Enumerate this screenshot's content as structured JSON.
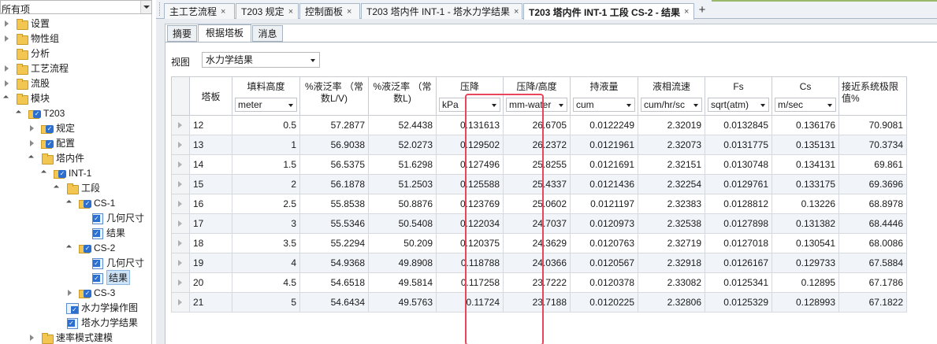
{
  "navigator": {
    "dropdown_value": "所有项",
    "tree": [
      {
        "label": "设置",
        "level": 0,
        "toggle": "col",
        "icon": "folder"
      },
      {
        "label": "物性组",
        "level": 0,
        "toggle": "col",
        "icon": "folder"
      },
      {
        "label": "分析",
        "level": 0,
        "toggle": "none",
        "icon": "folder"
      },
      {
        "label": "工艺流程",
        "level": 0,
        "toggle": "col",
        "icon": "folder"
      },
      {
        "label": "流股",
        "level": 0,
        "toggle": "col",
        "icon": "folder"
      },
      {
        "label": "模块",
        "level": 0,
        "toggle": "exp",
        "icon": "folder"
      },
      {
        "label": "T203",
        "level": 1,
        "toggle": "exp",
        "icon": "fchk"
      },
      {
        "label": "规定",
        "level": 2,
        "toggle": "col",
        "icon": "fchk"
      },
      {
        "label": "配置",
        "level": 2,
        "toggle": "col",
        "icon": "fchk"
      },
      {
        "label": "塔内件",
        "level": 2,
        "toggle": "exp",
        "icon": "folder"
      },
      {
        "label": "INT-1",
        "level": 3,
        "toggle": "exp",
        "icon": "fchk"
      },
      {
        "label": "工段",
        "level": 4,
        "toggle": "exp",
        "icon": "folder"
      },
      {
        "label": "CS-1",
        "level": 5,
        "toggle": "exp",
        "icon": "fchk"
      },
      {
        "label": "几何尺寸",
        "level": 6,
        "toggle": "none",
        "icon": "form"
      },
      {
        "label": "结果",
        "level": 6,
        "toggle": "none",
        "icon": "form"
      },
      {
        "label": "CS-2",
        "level": 5,
        "toggle": "exp",
        "icon": "fchk"
      },
      {
        "label": "几何尺寸",
        "level": 6,
        "toggle": "none",
        "icon": "form"
      },
      {
        "label": "结果",
        "level": 6,
        "toggle": "none",
        "icon": "form",
        "selected": true
      },
      {
        "label": "CS-3",
        "level": 5,
        "toggle": "col",
        "icon": "fchk"
      },
      {
        "label": "水力学操作图",
        "level": 4,
        "toggle": "none",
        "icon": "chart"
      },
      {
        "label": "塔水力学结果",
        "level": 4,
        "toggle": "none",
        "icon": "form"
      },
      {
        "label": "速率模式建模",
        "level": 2,
        "toggle": "col",
        "icon": "folder"
      }
    ]
  },
  "doc_tabs": [
    {
      "label": "主工艺流程",
      "close": "×"
    },
    {
      "label": "T203 规定",
      "close": "×"
    },
    {
      "label": "控制面板",
      "close": "×"
    },
    {
      "label": "T203 塔内件 INT-1 - 塔水力学结果",
      "close": "×"
    },
    {
      "label": "T203 塔内件 INT-1 工段 CS-2 - 结果",
      "close": "×",
      "active": true
    }
  ],
  "add_tab": "+",
  "sub_tabs": [
    {
      "label": "摘要"
    },
    {
      "label": "根据塔板",
      "active": true
    },
    {
      "label": "消息"
    }
  ],
  "view": {
    "label": "视图",
    "value": "水力学结果"
  },
  "columns": [
    {
      "name": "塔板",
      "unit": null
    },
    {
      "name": "填料高度",
      "unit": "meter"
    },
    {
      "name": "%液泛率 （常数L/V)",
      "unit": null
    },
    {
      "name": "%液泛率 （常数L)",
      "unit": null
    },
    {
      "name": "压降",
      "unit": "kPa"
    },
    {
      "name": "压降/高度",
      "unit": "mm-water"
    },
    {
      "name": "持液量",
      "unit": "cum"
    },
    {
      "name": "液相流速",
      "unit": "cum/hr/sc"
    },
    {
      "name": "Fs",
      "unit": "sqrt(atm)"
    },
    {
      "name": "Cs",
      "unit": "m/sec"
    },
    {
      "name": "接近系统极限值%",
      "unit": null
    }
  ],
  "rows": [
    [
      "12",
      "0.5",
      "57.2877",
      "52.4438",
      "0.131613",
      "26.6705",
      "0.0122249",
      "2.32019",
      "0.0132845",
      "0.136176",
      "70.9081"
    ],
    [
      "13",
      "1",
      "56.9038",
      "52.0273",
      "0.129502",
      "26.2372",
      "0.0121961",
      "2.32073",
      "0.0131775",
      "0.135131",
      "70.3734"
    ],
    [
      "14",
      "1.5",
      "56.5375",
      "51.6298",
      "0.127496",
      "25.8255",
      "0.0121691",
      "2.32151",
      "0.0130748",
      "0.134131",
      "69.861"
    ],
    [
      "15",
      "2",
      "56.1878",
      "51.2503",
      "0.125588",
      "25.4337",
      "0.0121436",
      "2.32254",
      "0.0129761",
      "0.133175",
      "69.3696"
    ],
    [
      "16",
      "2.5",
      "55.8538",
      "50.8876",
      "0.123769",
      "25.0602",
      "0.0121197",
      "2.32383",
      "0.0128812",
      "0.13226",
      "68.8978"
    ],
    [
      "17",
      "3",
      "55.5346",
      "50.5408",
      "0.122034",
      "24.7037",
      "0.0120973",
      "2.32538",
      "0.0127898",
      "0.131382",
      "68.4446"
    ],
    [
      "18",
      "3.5",
      "55.2294",
      "50.209",
      "0.120375",
      "24.3629",
      "0.0120763",
      "2.32719",
      "0.0127018",
      "0.130541",
      "68.0086"
    ],
    [
      "19",
      "4",
      "54.9368",
      "49.8908",
      "0.118788",
      "24.0366",
      "0.0120567",
      "2.32918",
      "0.0126167",
      "0.129733",
      "67.5884"
    ],
    [
      "20",
      "4.5",
      "54.6518",
      "49.5814",
      "0.117258",
      "23.7222",
      "0.0120378",
      "2.33082",
      "0.0125341",
      "0.12895",
      "67.1786"
    ],
    [
      "21",
      "5",
      "54.6434",
      "49.5763",
      "0.11724",
      "23.7188",
      "0.0120225",
      "2.32806",
      "0.0125329",
      "0.128993",
      "67.1822"
    ]
  ],
  "colors": {
    "highlight": "#e8475b",
    "selection": "#cde3f7",
    "alt_row": "#f1f4f9"
  }
}
